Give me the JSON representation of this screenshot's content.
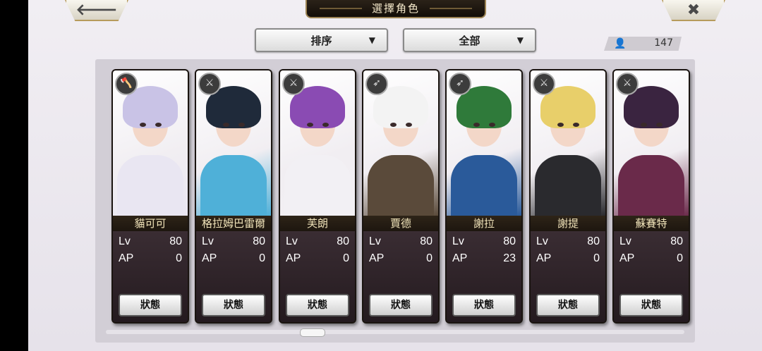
{
  "header": {
    "title": "選擇角色",
    "back_icon": "arrow-left-icon",
    "close_icon": "close-icon",
    "back_glyph": "🡐",
    "close_glyph": "✖"
  },
  "filters": {
    "sort_label": "排序",
    "category_label": "全部",
    "arrow_glyph": "▼"
  },
  "roster": {
    "count": "147",
    "user_icon": "person-icon"
  },
  "labels": {
    "lv": "Lv",
    "ap": "AP",
    "status_button": "狀態"
  },
  "characters": [
    {
      "name": "貓可可",
      "lv": "80",
      "ap": "0",
      "weapon_icon": "axe-icon",
      "hair": "#c9c3e6",
      "outfit": "#e9e6f2"
    },
    {
      "name": "格拉姆巴雷爾",
      "lv": "80",
      "ap": "0",
      "weapon_icon": "sword-icon",
      "hair": "#1f2a3a",
      "outfit": "#4fb0d8"
    },
    {
      "name": "芙朗",
      "lv": "80",
      "ap": "0",
      "weapon_icon": "sword-icon",
      "hair": "#8a4bb3",
      "outfit": "#f2f0f4"
    },
    {
      "name": "賈德",
      "lv": "80",
      "ap": "0",
      "weapon_icon": "spear-icon",
      "hair": "#f3f3f3",
      "outfit": "#5a4a3a"
    },
    {
      "name": "謝拉",
      "lv": "80",
      "ap": "23",
      "weapon_icon": "spear-icon",
      "hair": "#2f7a3a",
      "outfit": "#2a5a9a"
    },
    {
      "name": "謝提",
      "lv": "80",
      "ap": "0",
      "weapon_icon": "sword-icon",
      "hair": "#e8cf6a",
      "outfit": "#2a2a2e"
    },
    {
      "name": "蘇賽特",
      "lv": "80",
      "ap": "0",
      "weapon_icon": "sword-icon",
      "hair": "#3a2440",
      "outfit": "#6a2a4a"
    }
  ]
}
